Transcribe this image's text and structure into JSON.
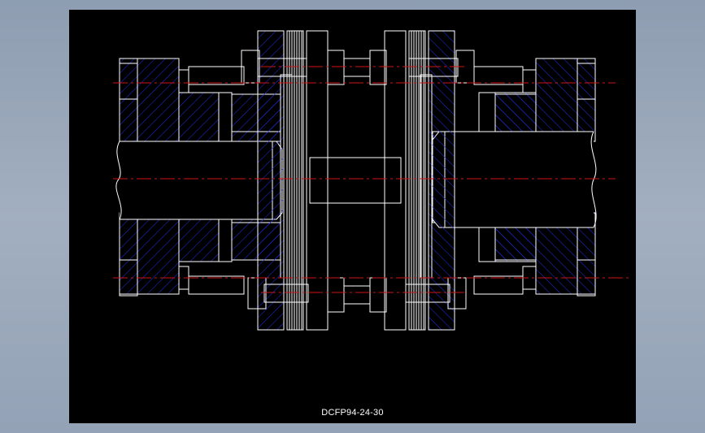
{
  "drawing": {
    "caption": "DCFP94-24-30",
    "colors": {
      "background": "#000000",
      "outline": "#ffffff",
      "hatch": "#1d2bd6",
      "centerline": "#d11414",
      "surround": "#9aa8ba"
    },
    "subject": "diaphragm-coupling-cross-section"
  }
}
